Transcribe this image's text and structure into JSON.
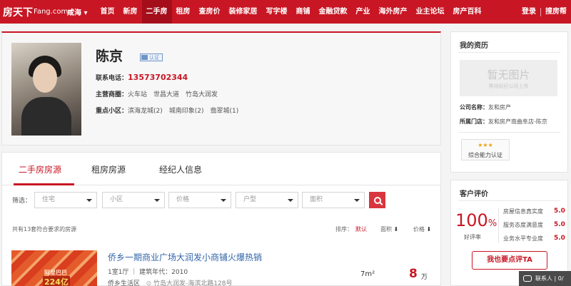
{
  "nav": {
    "logo_main": "房天下",
    "logo_sub": "Fang.com",
    "city": "咸海 ▾",
    "items": [
      "首页",
      "新房",
      "二手房",
      "租房",
      "查房价",
      "装修家居",
      "写字楼",
      "商铺",
      "金融贷款",
      "产业",
      "海外房产",
      "业主论坛",
      "房产百科"
    ],
    "active_index": 2,
    "login": "登录",
    "agent_help": "搜房帮"
  },
  "profile": {
    "name": "陈京",
    "verify_badge": "认证",
    "phone_label": "联系电话：",
    "phone": "13573702344",
    "areas_label": "主营商圈：",
    "areas": [
      "火车站",
      "世昌大道",
      "竹岛大润发"
    ],
    "communities_label": "重点小区：",
    "communities": [
      "滨海龙城(2)",
      "城南印象(2)",
      "翡翠城(1)"
    ]
  },
  "listing": {
    "tabs": [
      "二手房房源",
      "租房房源",
      "经纪人信息"
    ],
    "active_tab": 0,
    "filter_label": "筛选：",
    "filters": [
      "住宅",
      "小区",
      "价格",
      "户型",
      "面积"
    ],
    "result_text": "共有13套符合要求的房源",
    "sort_label": "排序：",
    "sort_default": "默认",
    "sort_area": "面积",
    "sort_price": "价格",
    "sort_arrow": "⬇",
    "item": {
      "title": "侨乡一期商业广场大润发小商铺火爆热销",
      "meta": "1室1厅 ｜ 建筑年代：2010",
      "district": "侨乡生活区",
      "road": "竹岛大润发-海滨北路128号",
      "area": "7m²",
      "price": "8",
      "price_unit": "万",
      "thumb_text1": "阿里巴巴",
      "thumb_text2": "224亿"
    }
  },
  "resume": {
    "title": "我的资历",
    "nopic_main": "暂无图片",
    "nopic_sub": "等待经纪公司上传",
    "company_label": "公司名称：",
    "company": "友和房产",
    "store_label": "所属门店：",
    "store": "友和房产南曲阜店-陈京",
    "cert_stars": "★★★",
    "cert_text": "综合能力认证"
  },
  "reviews": {
    "title": "客户评价",
    "pct": "100",
    "pct_unit": "%",
    "pct_label": "好评率",
    "ratings": [
      {
        "label": "房屋信息真实度",
        "value": "5.0"
      },
      {
        "label": "服务态度满意度",
        "value": "5.0"
      },
      {
        "label": "业务水平专业度",
        "value": "5.0"
      }
    ],
    "button": "我也要点评TA"
  },
  "chat": {
    "label": "联系人 | 0/"
  },
  "colors": {
    "brand_red": "#c81624",
    "link_blue": "#3064a9"
  }
}
